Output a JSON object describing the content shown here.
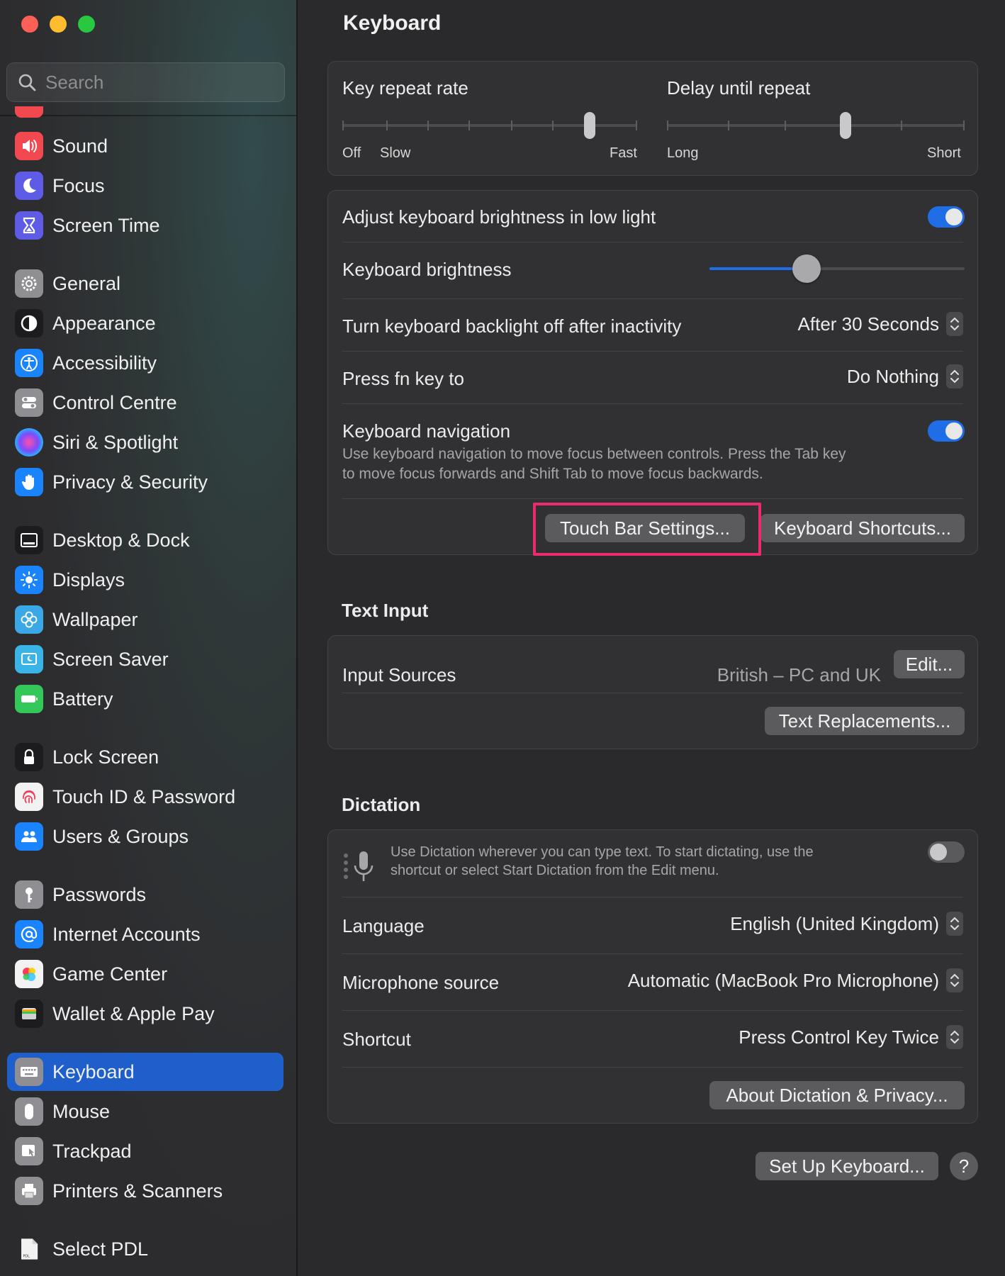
{
  "sidebar": {
    "search_placeholder": "Search",
    "items": [
      {
        "label": "Sound",
        "icon": "speaker-icon",
        "color": "#f2484f"
      },
      {
        "label": "Focus",
        "icon": "moon-icon",
        "color": "#5e5ce6"
      },
      {
        "label": "Screen Time",
        "icon": "hourglass-icon",
        "color": "#5e5ce6"
      },
      {
        "label": "General",
        "icon": "gear-icon",
        "color": "#8e8e93"
      },
      {
        "label": "Appearance",
        "icon": "appearance-icon",
        "color": "#1c1c1e"
      },
      {
        "label": "Accessibility",
        "icon": "accessibility-icon",
        "color": "#1a84ff"
      },
      {
        "label": "Control Centre",
        "icon": "control-centre-icon",
        "color": "#8e8e93"
      },
      {
        "label": "Siri & Spotlight",
        "icon": "siri-icon",
        "color": "#2b2b6e"
      },
      {
        "label": "Privacy & Security",
        "icon": "hand-icon",
        "color": "#1a84ff"
      },
      {
        "label": "Desktop & Dock",
        "icon": "dock-icon",
        "color": "#1c1c1e"
      },
      {
        "label": "Displays",
        "icon": "sun-icon",
        "color": "#1a84ff"
      },
      {
        "label": "Wallpaper",
        "icon": "flower-icon",
        "color": "#3aa8e6"
      },
      {
        "label": "Screen Saver",
        "icon": "screen-saver-icon",
        "color": "#3ab4e6"
      },
      {
        "label": "Battery",
        "icon": "battery-icon",
        "color": "#34c759"
      },
      {
        "label": "Lock Screen",
        "icon": "lock-icon",
        "color": "#1c1c1e"
      },
      {
        "label": "Touch ID & Password",
        "icon": "fingerprint-icon",
        "color": "#f2f2f2"
      },
      {
        "label": "Users & Groups",
        "icon": "users-icon",
        "color": "#1a84ff"
      },
      {
        "label": "Passwords",
        "icon": "key-icon",
        "color": "#8e8e93"
      },
      {
        "label": "Internet Accounts",
        "icon": "at-icon",
        "color": "#1a84ff"
      },
      {
        "label": "Game Center",
        "icon": "game-center-icon",
        "color": "#f2f2f2"
      },
      {
        "label": "Wallet & Apple Pay",
        "icon": "wallet-icon",
        "color": "#1c1c1e"
      },
      {
        "label": "Keyboard",
        "icon": "keyboard-icon",
        "color": "#8e8e93",
        "selected": true
      },
      {
        "label": "Mouse",
        "icon": "mouse-icon",
        "color": "#8e8e93"
      },
      {
        "label": "Trackpad",
        "icon": "trackpad-icon",
        "color": "#8e8e93"
      },
      {
        "label": "Printers & Scanners",
        "icon": "printer-icon",
        "color": "#8e8e93"
      },
      {
        "label": "Select PDL",
        "icon": "pdl-file-icon",
        "color": "#f2f2f2"
      }
    ]
  },
  "main": {
    "title": "Keyboard",
    "key_repeat": {
      "title": "Key repeat rate",
      "label_off": "Off",
      "label_slow": "Slow",
      "label_fast": "Fast",
      "level_fraction": 0.84
    },
    "delay_repeat": {
      "title": "Delay until repeat",
      "label_long": "Long",
      "label_short": "Short",
      "level_fraction": 0.6
    },
    "brightness_auto": {
      "label": "Adjust keyboard brightness in low light",
      "on": true
    },
    "brightness": {
      "label": "Keyboard brightness",
      "level_fraction": 0.38
    },
    "backlight_off": {
      "label": "Turn keyboard backlight off after inactivity",
      "value": "After 30 Seconds"
    },
    "fn_key": {
      "label": "Press fn key to",
      "value": "Do Nothing"
    },
    "keyboard_nav": {
      "label": "Keyboard navigation",
      "description_line1": "Use keyboard navigation to move focus between controls. Press the Tab key",
      "description_line2": "to move focus forwards and Shift Tab to move focus backwards.",
      "on": true
    },
    "buttons": {
      "touch_bar": "Touch Bar Settings...",
      "shortcuts": "Keyboard Shortcuts..."
    },
    "text_input": {
      "title": "Text Input",
      "input_sources_label": "Input Sources",
      "input_sources_value": "British – PC and UK",
      "edit_button": "Edit...",
      "text_replacements_button": "Text Replacements..."
    },
    "dictation": {
      "title": "Dictation",
      "description_line1": "Use Dictation wherever you can type text. To start dictating, use the",
      "description_line2": "shortcut or select Start Dictation from the Edit menu.",
      "on": false,
      "language_label": "Language",
      "language_value": "English (United Kingdom)",
      "mic_label": "Microphone source",
      "mic_value": "Automatic (MacBook Pro Microphone)",
      "shortcut_label": "Shortcut",
      "shortcut_value": "Press Control Key Twice",
      "about_button": "About Dictation & Privacy..."
    },
    "setup_button": "Set Up Keyboard...",
    "help_button": "?"
  },
  "colors": {
    "accent": "#1f6ee8",
    "highlight": "#ee2a6f",
    "sidebar_selected": "#1e5fcc"
  }
}
